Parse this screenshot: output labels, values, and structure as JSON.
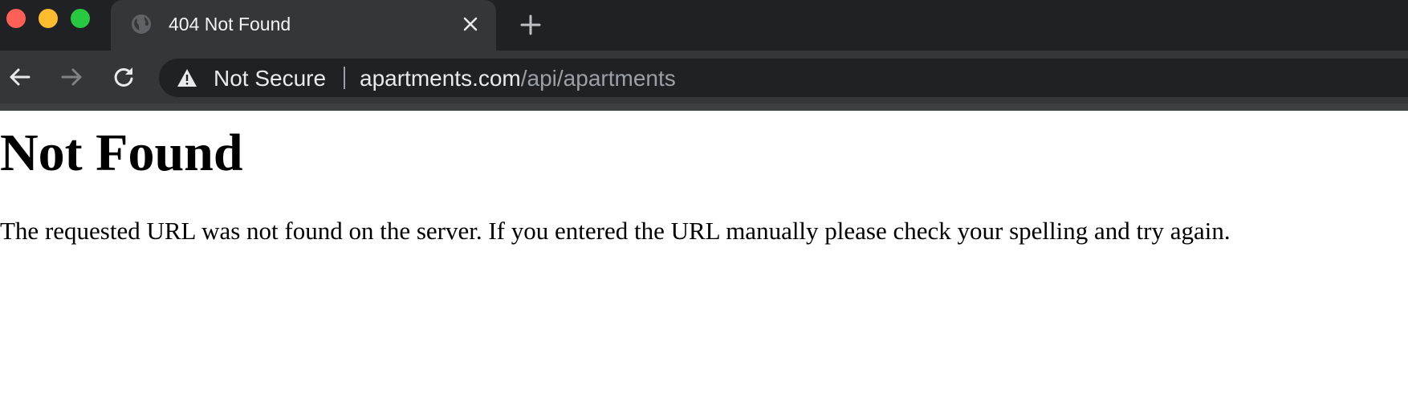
{
  "window": {
    "traffic_lights": {
      "close_color": "#fe5f57",
      "minimize_color": "#febc2e",
      "maximize_color": "#28c840"
    }
  },
  "tab": {
    "title": "404 Not Found",
    "favicon": "globe-icon",
    "close_icon": "close-icon"
  },
  "new_tab": {
    "icon": "plus-icon"
  },
  "toolbar": {
    "back_icon": "arrow-left-icon",
    "forward_icon": "arrow-right-icon",
    "reload_icon": "reload-icon"
  },
  "omnibox": {
    "security_icon": "warning-icon",
    "security_label": "Not Secure",
    "url_host": "apartments.com",
    "url_path": "/api/apartments"
  },
  "page": {
    "title": "Not Found",
    "message": "The requested URL was not found on the server. If you entered the URL manually please check your spelling and try again."
  },
  "colors": {
    "chrome_dark": "#202124",
    "tab_active": "#35363a",
    "text_light": "#e8eaed",
    "text_muted": "#9aa0a6",
    "page_background": "#ffffff",
    "page_text": "#000000"
  }
}
